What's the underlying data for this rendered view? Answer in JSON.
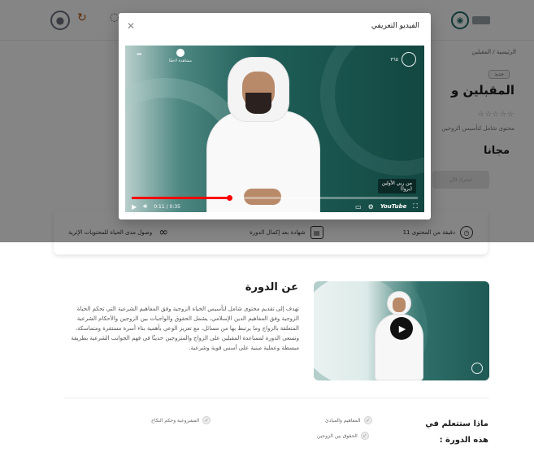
{
  "header": {
    "avatar_icon": "user-icon",
    "top_icon": "refresh-icon"
  },
  "hero": {
    "breadcrumb": "الرئيسية / المقبلين",
    "tag": "جديد",
    "title_fragment": "المقبلين و",
    "subtitle": "محتوى شامل لتأسيس الزوجين",
    "price": "مجانا",
    "enroll_label": "اشترك الآن"
  },
  "features": [
    {
      "icon": "clock-icon",
      "label": "11 دقيقة من المحتوى"
    },
    {
      "icon": "certificate-icon",
      "label": "شهادة بعد إكمال الدورة"
    },
    {
      "icon": "infinity-icon",
      "label": "وصول مدى الحياة للمحتويات الإثرية"
    }
  ],
  "about": {
    "title": "عن الدورة",
    "text": "تهدف إلى تقديم محتوى شامل لتأسيس الحياة الزوجية وفق المفاهيم الشرعية التي تحكم الحياة الزوجية وفق المفاهيم الدين الإسلامي، يشمل الحقوق والواجبات بين الزوجين والأحكام الشرعية المتعلقة بالزواج وما يرتبط بها من مسائل، مع تعزيز الوعي بأهمية بناء أسرة مستقرة ومتماسكة، وتسعى الدورة لمساعدة المقبلين على الزواج والمتزوجين حديثًا في فهم الجوانب الشرعية بطريقة مبسطة وعملية مبنية على أسس قوية وشرعية."
  },
  "learn": {
    "title": "ماذا ستتعلم في هذه الدورة :",
    "items": [
      "المفاهيم والمبادئ",
      "المشروعية وحكم النكاح",
      "الحقوق بين الزوجين"
    ]
  },
  "modal": {
    "title": "الفيديو التعريفي",
    "close_icon": "close-icon"
  },
  "video": {
    "channel_tag": "٣٦٥",
    "watch_later_label": "مشاهدة لاحقًا",
    "caption_line1": "من ربي الأولين",
    "caption_line2": "(بروا)",
    "time": "0:11 / 0:35",
    "brand": "YouTube",
    "progress": 0.34
  }
}
